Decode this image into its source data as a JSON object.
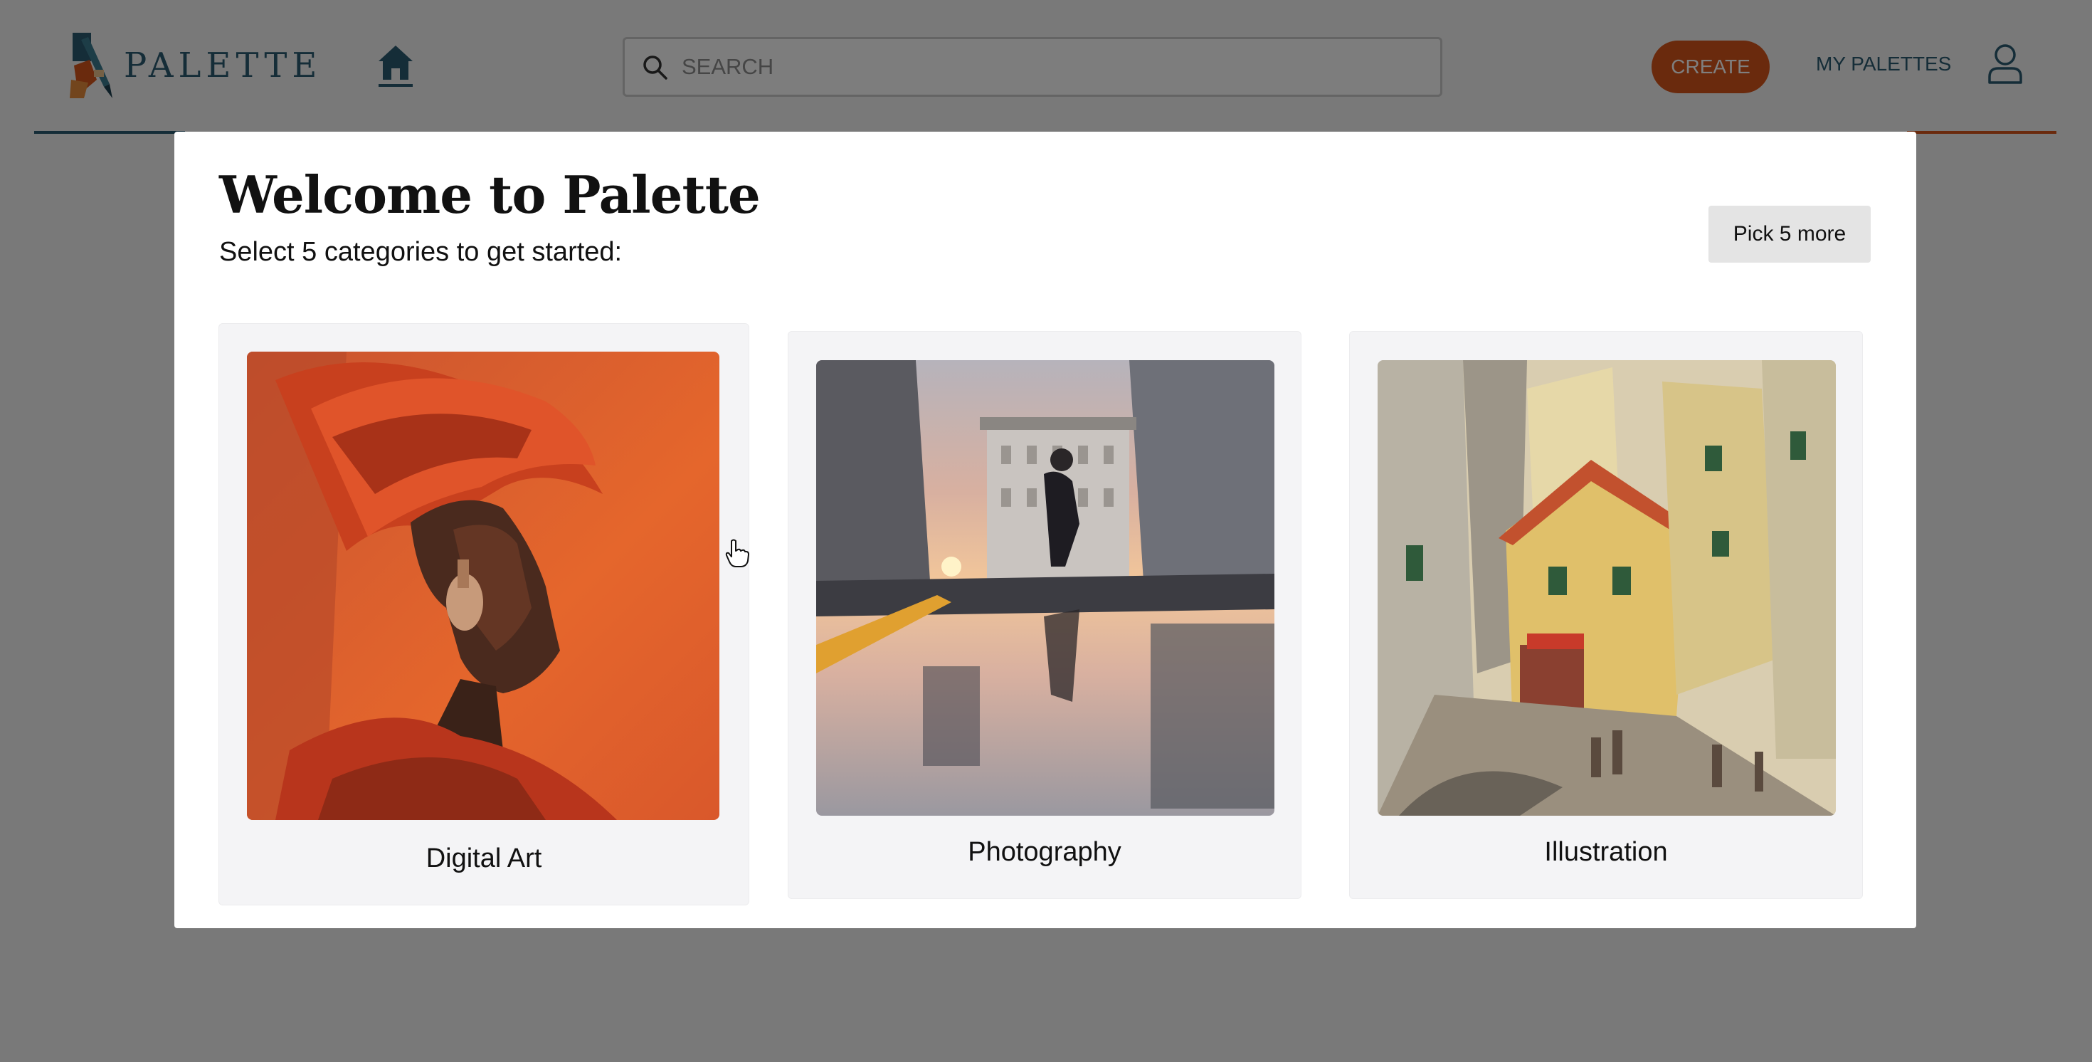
{
  "header": {
    "logo_text": "PALETTE",
    "search_placeholder": "SEARCH",
    "create_label": "CREATE",
    "my_palettes_label": "MY PALETTES"
  },
  "modal": {
    "title": "Welcome to Palette",
    "subtitle": "Select 5 categories to get started:",
    "pick_button": "Pick 5 more",
    "categories": [
      {
        "label": "Digital Art",
        "icon": "portrait-artwork-image"
      },
      {
        "label": "Photography",
        "icon": "street-reflection-photo"
      },
      {
        "label": "Illustration",
        "icon": "old-town-illustration-image"
      }
    ]
  },
  "colors": {
    "brand_teal": "#2a5a70",
    "brand_orange": "#d5541a"
  }
}
